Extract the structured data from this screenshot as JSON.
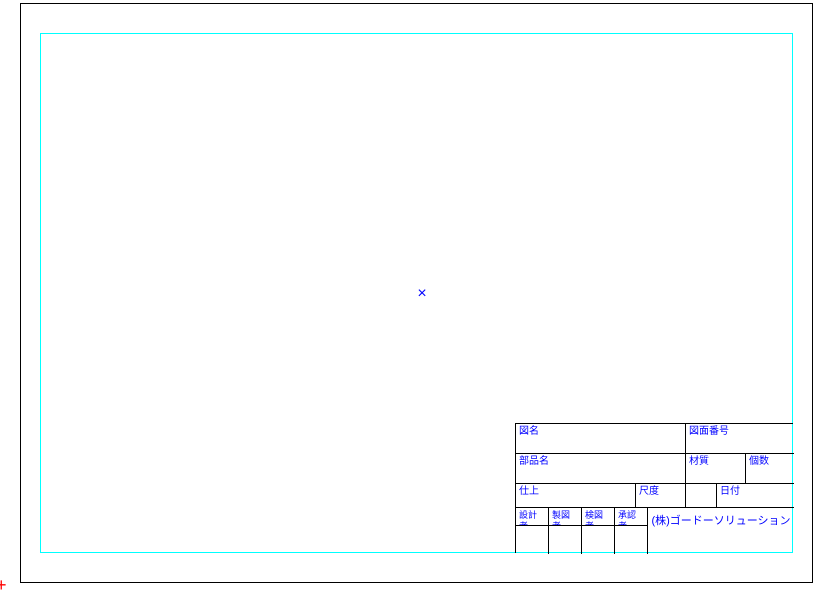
{
  "titleblock": {
    "drawing_name_label": "図名",
    "drawing_number_label": "図面番号",
    "part_name_label": "部品名",
    "material_label": "材質",
    "count_label": "個数",
    "finish_label": "仕上",
    "scale_label": "尺度",
    "date_label": "日付",
    "designer_label": "設計者",
    "drafter_label": "製図者",
    "checker_label": "検図者",
    "approver_label": "承認者",
    "company": "(株)ゴードーソリューション"
  },
  "marks": {
    "center": "×",
    "origin": "+"
  }
}
